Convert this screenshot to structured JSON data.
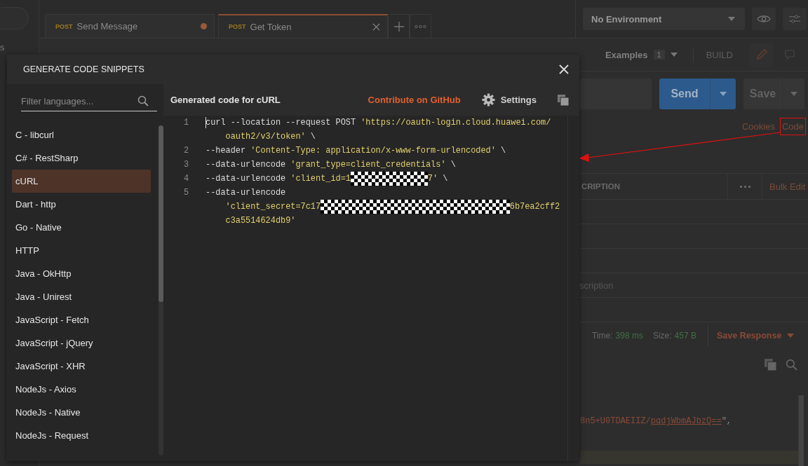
{
  "sidebar": {
    "items": [
      "s"
    ]
  },
  "tabs": [
    {
      "method": "POST",
      "label": "Send Message",
      "selected": false,
      "unsaved": true
    },
    {
      "method": "POST",
      "label": "Get Token",
      "selected": true,
      "unsaved": false
    }
  ],
  "environment": {
    "value": "No Environment"
  },
  "examples": {
    "label": "Examples",
    "count": "1"
  },
  "build_label": "BUILD",
  "send_button": "Send",
  "save_button": "Save",
  "links": [
    {
      "label": "Cookies",
      "highlighted": false
    },
    {
      "label": "Code",
      "highlighted": true
    }
  ],
  "params_table": {
    "column_header": "CRIPTION",
    "bulk_edit": "Bulk Edit",
    "placeholder": "scription"
  },
  "response": {
    "time_label": "Time:",
    "time": "398 ms",
    "size_label": "Size:",
    "size": "457 B",
    "save_response": "Save Response",
    "body": [
      {
        "kind": "string",
        "text": "8n5+U0TDAEIIZ/"
      },
      {
        "kind": "link",
        "text": "pqdjWbmAJbzQ=="
      },
      {
        "kind": "plain",
        "text": "\","
      }
    ]
  },
  "modal": {
    "title": "GENERATE CODE SNIPPETS",
    "filter": {
      "placeholder": "Filter languages..."
    },
    "languages": [
      {
        "label": "C - libcurl",
        "selected": false
      },
      {
        "label": "C# - RestSharp",
        "selected": false
      },
      {
        "label": "cURL",
        "selected": true
      },
      {
        "label": "Dart - http",
        "selected": false
      },
      {
        "label": "Go - Native",
        "selected": false
      },
      {
        "label": "HTTP",
        "selected": false
      },
      {
        "label": "Java - OkHttp",
        "selected": false
      },
      {
        "label": "Java - Unirest",
        "selected": false
      },
      {
        "label": "JavaScript - Fetch",
        "selected": false
      },
      {
        "label": "JavaScript - jQuery",
        "selected": false
      },
      {
        "label": "JavaScript - XHR",
        "selected": false
      },
      {
        "label": "NodeJs - Axios",
        "selected": false
      },
      {
        "label": "NodeJs - Native",
        "selected": false
      },
      {
        "label": "NodeJs - Request",
        "selected": false
      }
    ],
    "code_title": "Generated code for cURL",
    "contribute_link": "Contribute on GitHub",
    "settings": "Settings",
    "lines": [
      {
        "number": "1",
        "cursor": true,
        "wraps": [
          {
            "segments": [
              {
                "kind": "plain",
                "text": "curl --location --request POST "
              },
              {
                "kind": "string",
                "text": "'https://oauth-login.cloud.huawei.com/"
              }
            ]
          },
          {
            "segments": [
              {
                "kind": "string",
                "text": "oauth2/v3/token'"
              },
              {
                "kind": "plain",
                "text": " \\"
              }
            ]
          }
        ]
      },
      {
        "number": "2",
        "cursor": false,
        "wraps": [
          {
            "segments": [
              {
                "kind": "plain",
                "text": "--header "
              },
              {
                "kind": "string",
                "text": "'Content-Type: application/x-www-form-urlencoded'"
              },
              {
                "kind": "plain",
                "text": " \\"
              }
            ]
          }
        ]
      },
      {
        "number": "3",
        "cursor": false,
        "wraps": [
          {
            "segments": [
              {
                "kind": "plain",
                "text": "--data-urlencode "
              },
              {
                "kind": "string",
                "text": "'grant_type=client_credentials'"
              },
              {
                "kind": "plain",
                "text": " \\"
              }
            ]
          }
        ]
      },
      {
        "number": "4",
        "cursor": false,
        "wraps": [
          {
            "segments": [
              {
                "kind": "plain",
                "text": "--data-urlencode "
              },
              {
                "kind": "string",
                "text": "'client_id=1"
              },
              {
                "kind": "redacted"
              },
              {
                "kind": "string",
                "text": "7'"
              },
              {
                "kind": "plain",
                "text": " \\"
              }
            ]
          }
        ]
      },
      {
        "number": "5",
        "cursor": false,
        "wraps": [
          {
            "segments": [
              {
                "kind": "plain",
                "text": "--data-urlencode"
              }
            ]
          },
          {
            "segments": [
              {
                "kind": "string",
                "text": "'client_secret=7c17"
              },
              {
                "kind": "redacted"
              },
              {
                "kind": "string",
                "text": "6b7ea2cff2"
              }
            ]
          },
          {
            "segments": [
              {
                "kind": "string",
                "text": "c3a5514624db9'"
              }
            ]
          }
        ]
      }
    ]
  }
}
